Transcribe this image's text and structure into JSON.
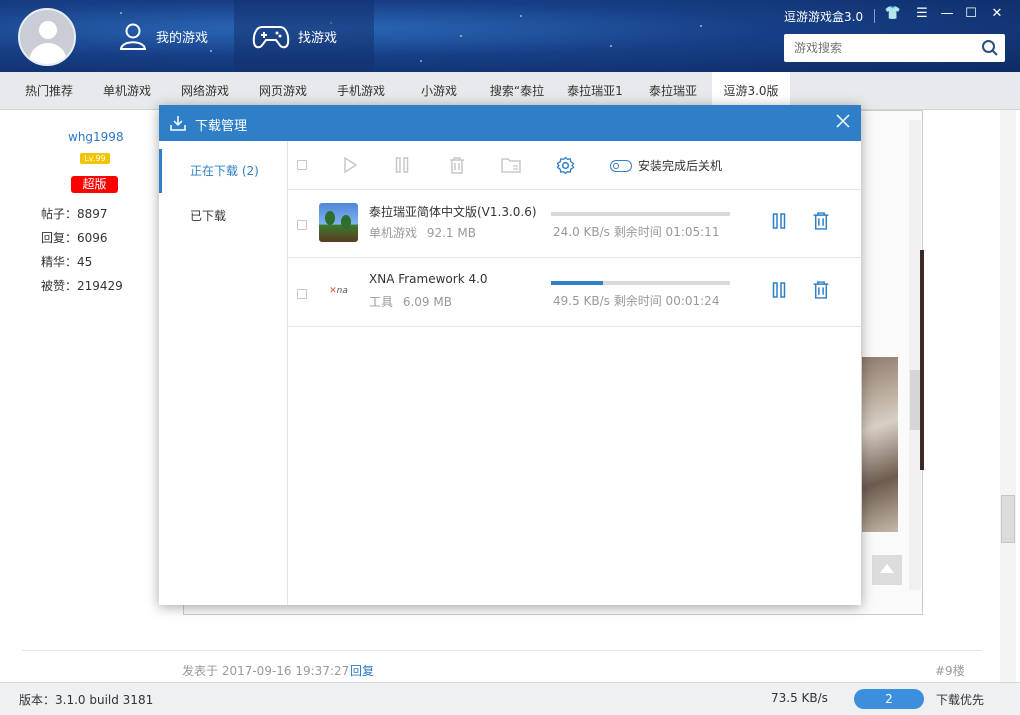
{
  "header": {
    "nav": [
      {
        "label": "我的游戏",
        "icon": "user-icon"
      },
      {
        "label": "找游戏",
        "icon": "gamepad-icon"
      }
    ],
    "brand": "逗游游戏盒3.0",
    "search_placeholder": "游戏搜索"
  },
  "tabs": [
    {
      "label": "热门推荐"
    },
    {
      "label": "单机游戏"
    },
    {
      "label": "网络游戏"
    },
    {
      "label": "网页游戏"
    },
    {
      "label": "手机游戏"
    },
    {
      "label": "小游戏"
    },
    {
      "label": "搜索“泰拉"
    },
    {
      "label": "泰拉瑞亚1"
    },
    {
      "label": "泰拉瑞亚"
    },
    {
      "label": "逗游3.0版"
    }
  ],
  "post": {
    "username": "whg1998",
    "level": "Lv.99",
    "badge": "超版",
    "stats": [
      "帖子：8897",
      "回复：6096",
      "精华：45",
      "被赞：219429"
    ],
    "time": "发表于 2017-09-16 19:37:27",
    "reply": "回复",
    "floor": "#9楼"
  },
  "dialog": {
    "title": "下载管理",
    "side": {
      "downloading": "正在下载 (2)",
      "downloaded": "已下载"
    },
    "toolbar": {
      "shutdown_label": "安装完成后关机"
    },
    "items": [
      {
        "name": "泰拉瑞亚简体中文版(V1.3.0.6)",
        "category": "单机游戏",
        "size": "92.1 MB",
        "status": "24.0 KB/s 剩余时间 01:05:11",
        "progress": 0
      },
      {
        "name": "XNA Framework 4.0",
        "category": "工具",
        "size": "6.09 MB",
        "status": "49.5 KB/s 剩余时间 00:01:24",
        "progress": 0.29
      }
    ]
  },
  "statusbar": {
    "version": "版本：3.1.0 build 3181",
    "speed": "73.5 KB/s",
    "count": "2",
    "priority": "下载优先"
  }
}
